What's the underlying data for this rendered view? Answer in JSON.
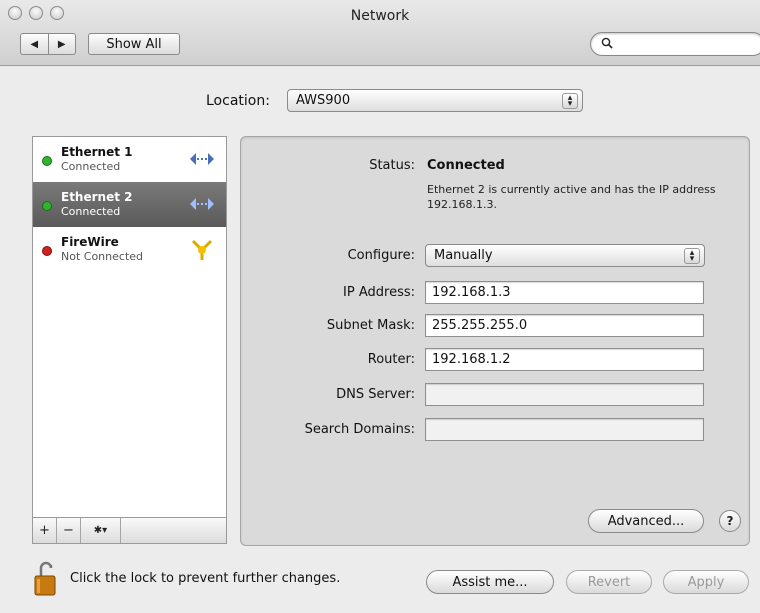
{
  "window": {
    "title": "Network"
  },
  "toolbar": {
    "back_glyph": "◀",
    "forward_glyph": "▶",
    "show_all_label": "Show All",
    "search_glyph": "🔍"
  },
  "location": {
    "label": "Location:",
    "value": "AWS900"
  },
  "services": [
    {
      "name": "Ethernet 1",
      "status": "Connected",
      "status_color": "#2db52d",
      "icon": "ethernet-icon",
      "selected": false
    },
    {
      "name": "Ethernet 2",
      "status": "Connected",
      "status_color": "#2db52d",
      "icon": "ethernet-icon",
      "selected": true
    },
    {
      "name": "FireWire",
      "status": "Not Connected",
      "status_color": "#d12020",
      "icon": "firewire-icon",
      "selected": false
    }
  ],
  "sidebar_bar": {
    "add": "+",
    "remove": "−",
    "action": "✱▾"
  },
  "details": {
    "status_label": "Status:",
    "status_value": "Connected",
    "status_desc": "Ethernet 2 is currently active and has the IP address 192.168.1.3.",
    "configure_label": "Configure:",
    "configure_value": "Manually",
    "ip_label": "IP Address:",
    "ip_value": "192.168.1.3",
    "subnet_label": "Subnet Mask:",
    "subnet_value": "255.255.255.0",
    "router_label": "Router:",
    "router_value": "192.168.1.2",
    "dns_label": "DNS Server:",
    "dns_value": "",
    "search_label": "Search Domains:",
    "search_value": "",
    "advanced_label": "Advanced...",
    "help_label": "?"
  },
  "footer": {
    "lock_text": "Click the lock to prevent further changes.",
    "assist_label": "Assist me...",
    "revert_label": "Revert",
    "apply_label": "Apply"
  }
}
